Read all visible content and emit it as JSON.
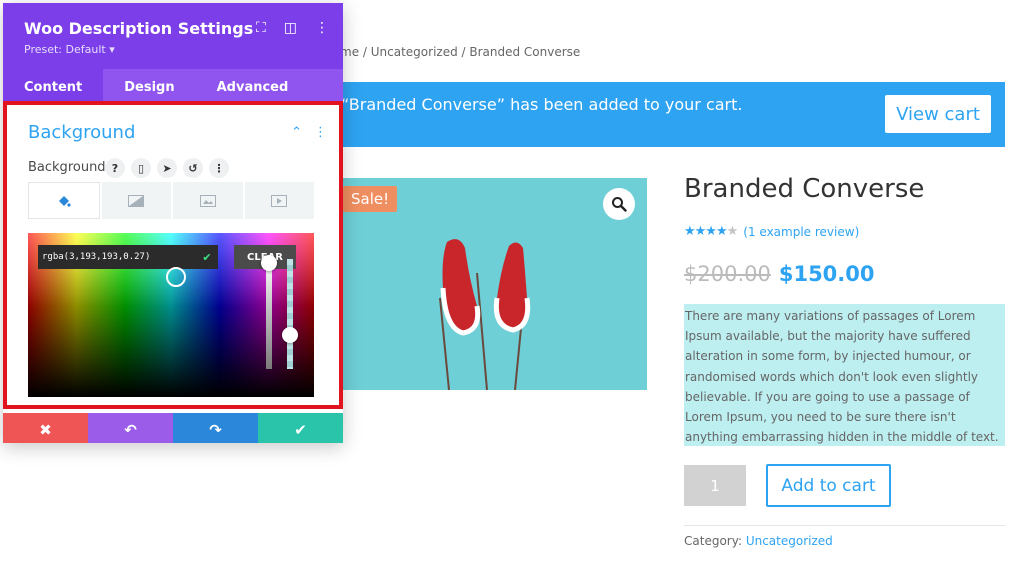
{
  "breadcrumb": "me / Uncategorized / Branded Converse",
  "notice": {
    "text": "“Branded Converse” has been added to your cart.",
    "view_cart_label": "View cart"
  },
  "product": {
    "sale_label": "Sale!",
    "zoom_icon": "magnifier-icon",
    "title": "Branded Converse",
    "rating": 4,
    "rating_max": 5,
    "review_link": "(1 example review)",
    "price_old": "$200.00",
    "price_new": "$150.00",
    "description": "There are many variations of passages of Lorem Ipsum available, but the majority have suffered alteration in some form, by injected humour, or randomised words which don't look even slightly believable. If you are going to use a passage of Lorem Ipsum, you need to be sure there isn't anything embarrassing hidden in the middle of text.",
    "quantity": "1",
    "add_to_cart_label": "Add to cart",
    "category_label": "Category:",
    "category_value": "Uncategorized",
    "highlight_color": "#bdeef0"
  },
  "panel": {
    "title": "Woo Description Settings",
    "preset": "Preset: Default ▾",
    "tabs": [
      "Content",
      "Design",
      "Advanced"
    ],
    "active_tab": "Content",
    "section_title": "Background",
    "background_label": "Background",
    "label_icons": [
      "?",
      "▯",
      "➤",
      "↺",
      "⋮"
    ],
    "color_value": "rgba(3,193,193,0.27)",
    "clear_label": "CLEAR",
    "header_bg": "#7b3ee8",
    "accent": "#2ea3f2"
  },
  "footer": {
    "cancel_icon": "✖",
    "undo_icon": "↶",
    "redo_icon": "↷",
    "save_icon": "✔"
  }
}
